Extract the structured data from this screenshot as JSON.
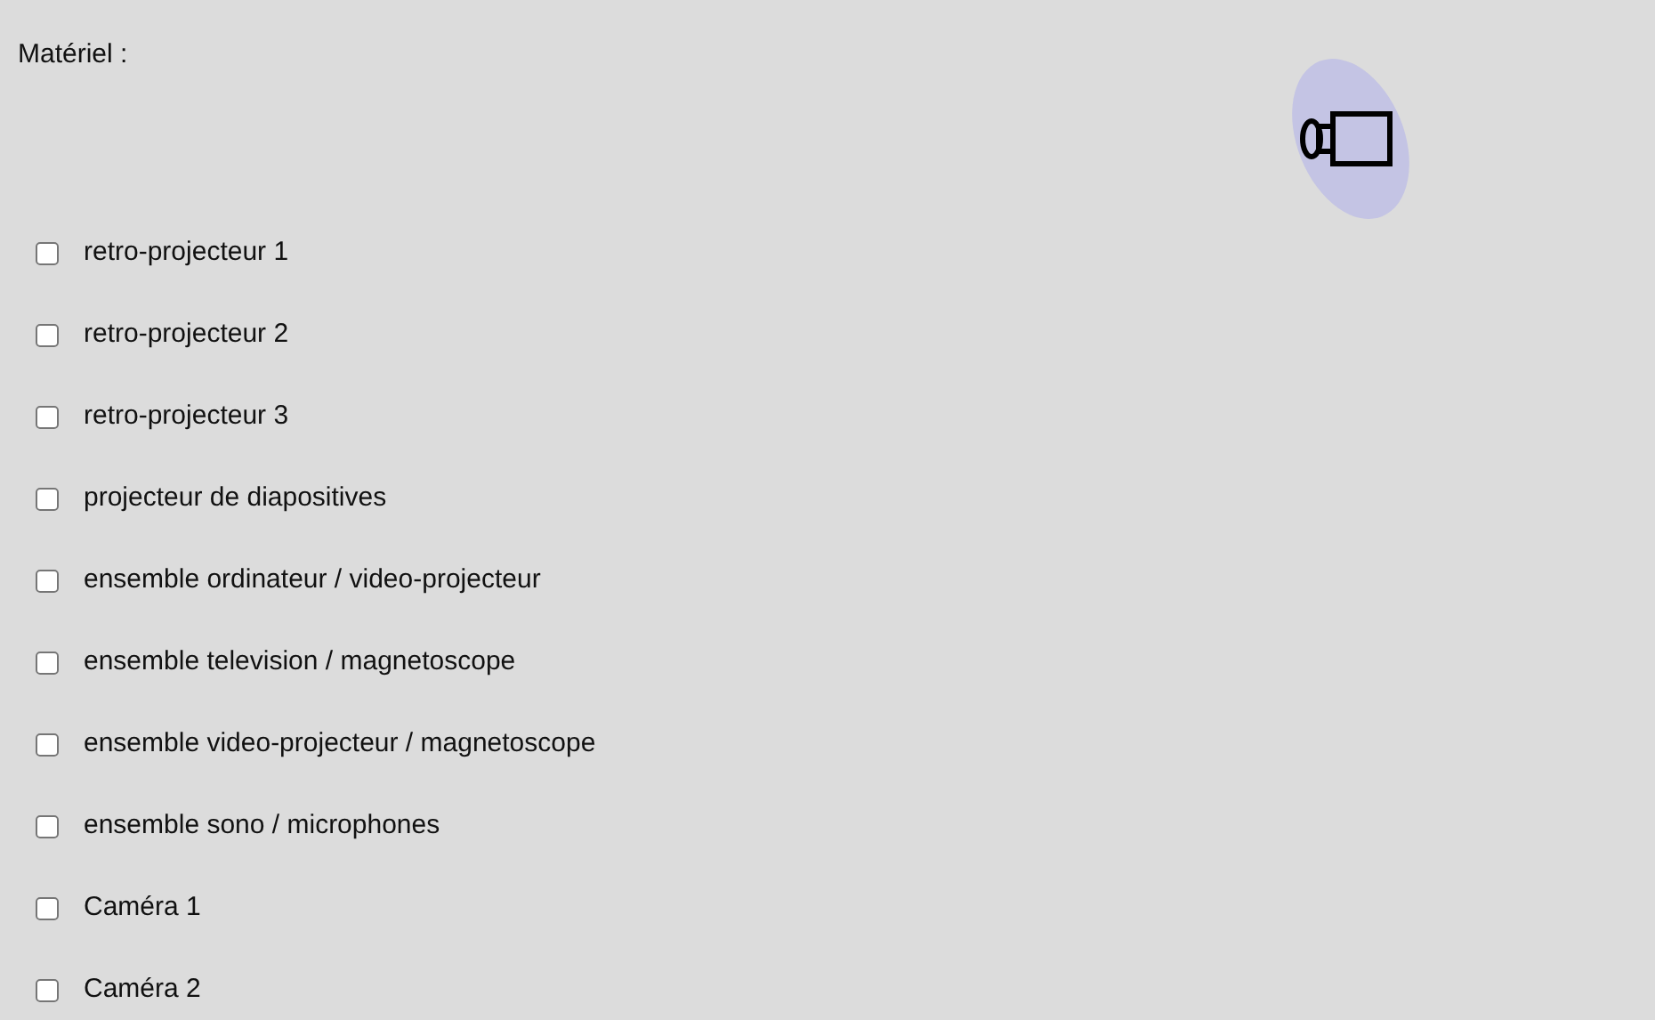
{
  "heading": "Matériel :",
  "items": [
    {
      "label": "retro-projecteur 1",
      "checked": false
    },
    {
      "label": "retro-projecteur 2",
      "checked": false
    },
    {
      "label": "retro-projecteur 3",
      "checked": false
    },
    {
      "label": "projecteur de diapositives",
      "checked": false
    },
    {
      "label": "ensemble ordinateur / video-projecteur",
      "checked": false
    },
    {
      "label": "ensemble television / magnetoscope",
      "checked": false
    },
    {
      "label": "ensemble video-projecteur / magnetoscope",
      "checked": false
    },
    {
      "label": "ensemble sono / microphones",
      "checked": false
    },
    {
      "label": "Caméra 1",
      "checked": false
    },
    {
      "label": "Caméra 2",
      "checked": false
    }
  ]
}
